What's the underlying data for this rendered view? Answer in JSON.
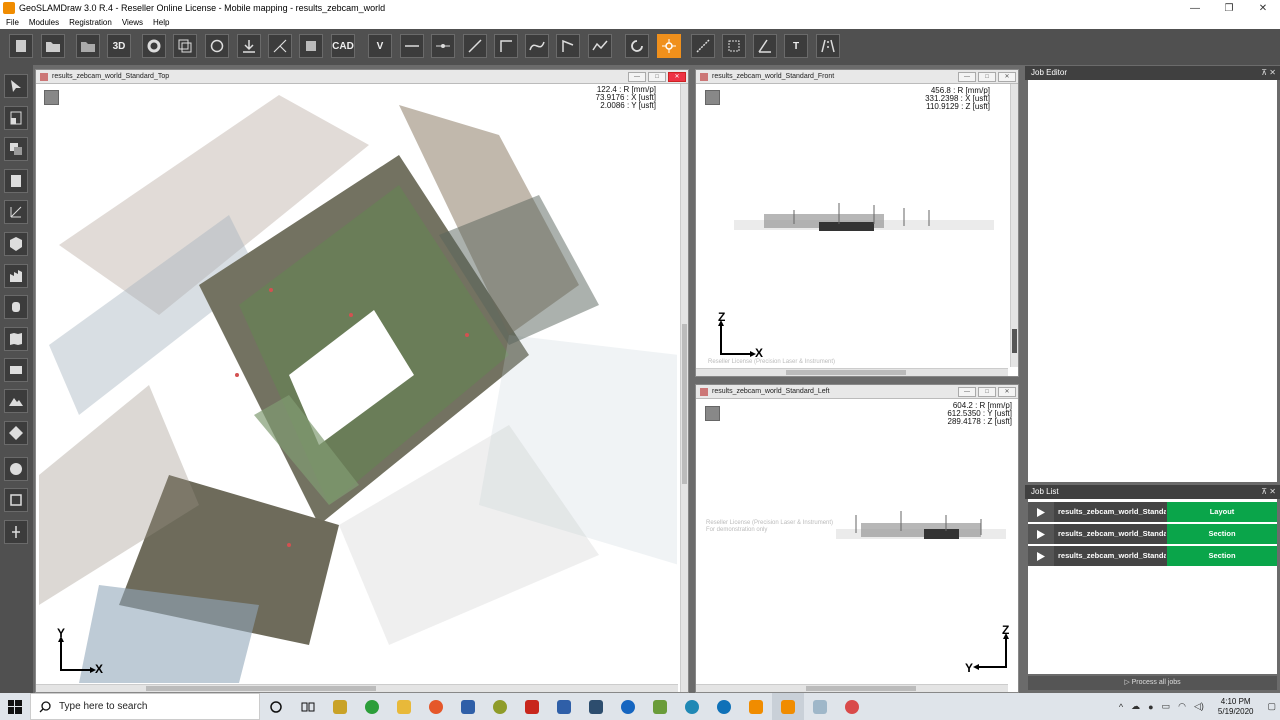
{
  "window": {
    "title": "GeoSLAMDraw 3.0 R.4 - Reseller Online License - Mobile mapping - results_zebcam_world",
    "controls": [
      "—",
      "❐",
      "✕"
    ]
  },
  "menu": [
    "File",
    "Modules",
    "Registration",
    "Views",
    "Help"
  ],
  "toolbar": {
    "labels": {
      "view3d": "3D",
      "cad": "CAD",
      "vertical": "V",
      "text": "T"
    },
    "active_color": "#f0901c"
  },
  "viewports": {
    "top": {
      "title": "results_zebcam_world_Standard_Top",
      "readout": [
        "122.4 : R [mm/p]",
        "73.9176 : X [usft]",
        "2.0086 : Y [usft]"
      ],
      "axis_v": "Y",
      "axis_h": "X"
    },
    "front": {
      "title": "results_zebcam_world_Standard_Front",
      "readout": [
        "456.8 : R [mm/p]",
        "331.2398 : X [usft]",
        "110.9129 : Z [usft]"
      ],
      "axis_v": "Z",
      "axis_h": "X",
      "watermark": "Reseller License (Precision Laser & Instrument)"
    },
    "left": {
      "title": "results_zebcam_world_Standard_Left",
      "readout": [
        "604.2 : R [mm/p]",
        "612.5350 : Y [usft]",
        "289.4178 : Z [usft]"
      ],
      "axis_v": "Z",
      "axis_h": "Y",
      "watermark": "Reseller License (Precision Laser & Instrument)",
      "watermark2": "For demonstration only"
    }
  },
  "job_editor": {
    "title": "Job Editor"
  },
  "job_list": {
    "title": "Job List",
    "jobs": [
      {
        "name": "results_zebcam_world_Standard",
        "type": "Layout"
      },
      {
        "name": "results_zebcam_world_Standard",
        "type": "Section"
      },
      {
        "name": "results_zebcam_world_Standard",
        "type": "Section"
      }
    ],
    "process_label": "Process all jobs",
    "type_color": "#0aa54a"
  },
  "taskbar": {
    "search_placeholder": "Type here to search",
    "time": "4:10 PM",
    "date": "5/19/2020"
  }
}
